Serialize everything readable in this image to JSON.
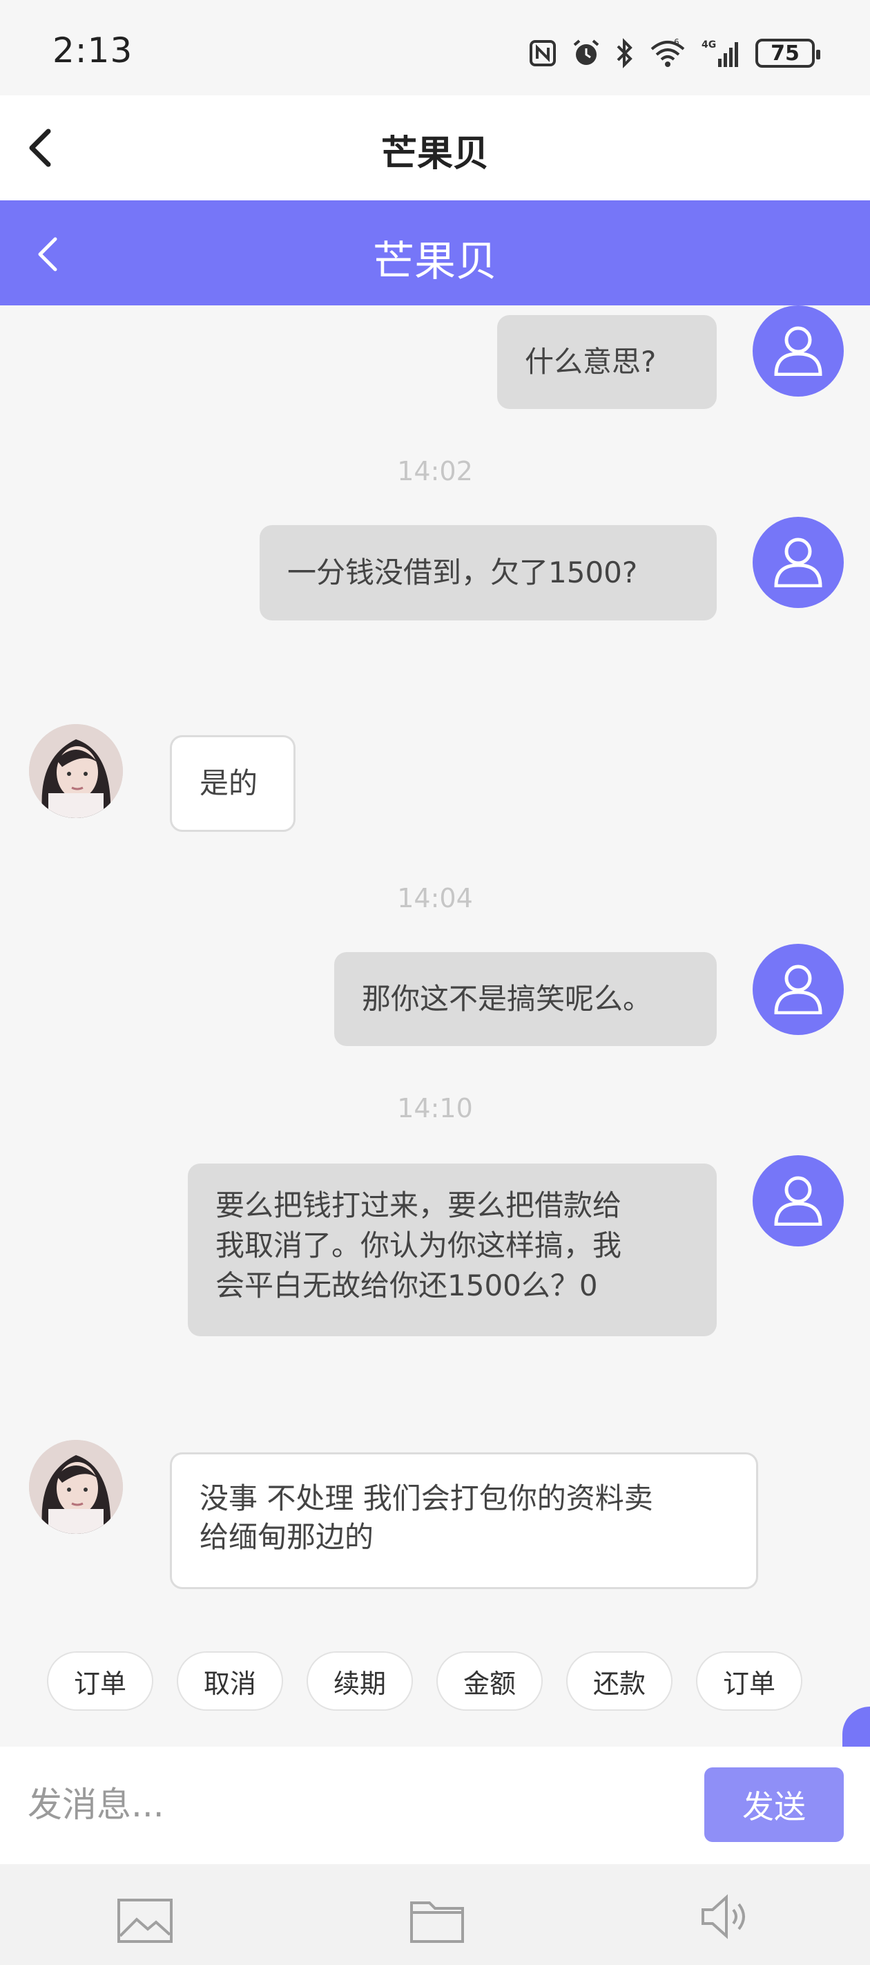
{
  "status_bar": {
    "time": "2:13",
    "battery": "75"
  },
  "app_header": {
    "title": "芒果贝"
  },
  "chat_header": {
    "title": "芒果贝"
  },
  "messages": [
    {
      "side": "out",
      "text": "什么意思?"
    },
    {
      "timestamp": "14:02"
    },
    {
      "side": "out",
      "text": "一分钱没借到，欠了1500?"
    },
    {
      "side": "in",
      "text": "是的"
    },
    {
      "timestamp": "14:04"
    },
    {
      "side": "out",
      "text": "那你这不是搞笑呢么。"
    },
    {
      "timestamp": "14:10"
    },
    {
      "side": "out",
      "lines": [
        "要么把钱打过来，要么把借款给",
        "我取消了。你认为你这样搞，我",
        "会平白无故给你还1500么？0"
      ]
    },
    {
      "side": "in",
      "lines": [
        "没事 不处理 我们会打包你的资料卖",
        "给缅甸那边的"
      ]
    }
  ],
  "quick_replies": [
    "订单",
    "取消",
    "续期",
    "金额",
    "还款",
    "订单"
  ],
  "composer": {
    "placeholder": "发消息...",
    "send_label": "发送"
  },
  "toolbar": {
    "icons": [
      "image-icon",
      "folder-icon",
      "speaker-icon"
    ]
  },
  "colors": {
    "accent": "#7676f8",
    "send_button": "#8f8ff7",
    "bubble_out": "#dcdcdc",
    "bubble_in": "#ffffff",
    "background": "#f6f6f6"
  }
}
